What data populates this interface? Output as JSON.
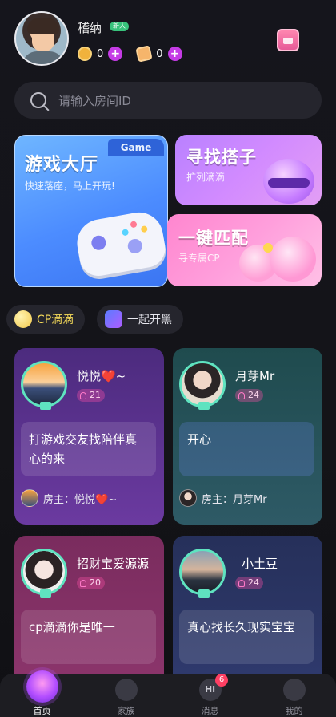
{
  "profile": {
    "name": "稽纳",
    "badge": "新人",
    "coins": "0",
    "diamonds": "0"
  },
  "search": {
    "placeholder": "请输入房间ID"
  },
  "banners": {
    "game": {
      "title": "游戏大厅",
      "tag": "Game",
      "subtitle": "快速落座，马上开玩!"
    },
    "find": {
      "title": "寻找搭子",
      "subtitle": "扩列滴滴"
    },
    "match": {
      "title": "一键匹配",
      "subtitle": "寻专属CP"
    }
  },
  "chips": [
    {
      "label": "CP滴滴"
    },
    {
      "label": "一起开黑"
    }
  ],
  "rooms": [
    {
      "name": "悦悦❤️~",
      "count": "21",
      "desc": "打游戏交友找陪伴真心的来",
      "host_prefix": "房主：",
      "host": "悦悦❤️~"
    },
    {
      "name": "月芽Mr",
      "count": "24",
      "desc": "开心",
      "host_prefix": "房主：",
      "host": "月芽Mr"
    },
    {
      "name": "招财宝爱源源",
      "count": "20",
      "desc": "cp滴滴你是唯一"
    },
    {
      "name": "小土豆",
      "count": "24",
      "desc": "真心找长久现实宝宝"
    }
  ],
  "tabbar": {
    "items": [
      {
        "label": "首页"
      },
      {
        "label": "家族"
      },
      {
        "label": "消息",
        "badge": "6",
        "icon_text": "Hi"
      },
      {
        "label": "我的"
      }
    ]
  }
}
